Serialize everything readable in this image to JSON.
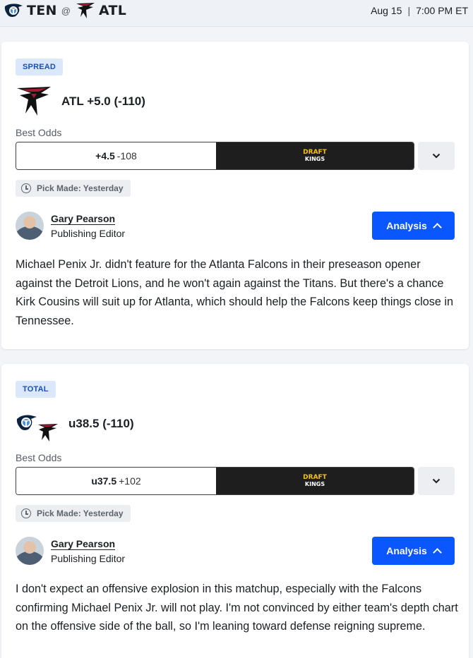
{
  "header": {
    "away_team": "TEN",
    "at_symbol": "@",
    "home_team": "ATL",
    "date": "Aug 15",
    "separator": "|",
    "time": "7:00 PM ET"
  },
  "picks": [
    {
      "badge": "SPREAD",
      "pick_label": "ATL +5.0 (-110)",
      "best_odds_label": "Best Odds",
      "odds_line": "+4.5",
      "odds_price": "-108",
      "sportsbook": {
        "top": "DRAFT",
        "bottom": "KINGS"
      },
      "pick_made": "Pick Made: Yesterday",
      "author_name": "Gary Pearson",
      "author_role": "Publishing Editor",
      "analysis_label": "Analysis",
      "body": "Michael Penix Jr. didn't feature for the Atlanta Falcons in their preseason opener against the Detroit Lions, and he won't again against the Titans. But there's a chance Kirk Cousins will suit up for Atlanta, which should help the Falcons keep things close in Tennessee."
    },
    {
      "badge": "TOTAL",
      "pick_label": "u38.5 (-110)",
      "best_odds_label": "Best Odds",
      "odds_line": "u37.5",
      "odds_price": "+102",
      "sportsbook": {
        "top": "DRAFT",
        "bottom": "KINGS"
      },
      "pick_made": "Pick Made: Yesterday",
      "author_name": "Gary Pearson",
      "author_role": "Publishing Editor",
      "analysis_label": "Analysis",
      "body": "I don't expect an offensive explosion in this matchup, especially with the Falcons confirming Michael Penix Jr. will not play. I'm not convinced by either team's depth chart on the offensive side of the ball, so I'm leaning toward defense reigning supreme."
    }
  ],
  "icons": {
    "titans_logo": "titans-logo-icon",
    "falcons_logo": "falcons-logo-icon",
    "clock": "clock-icon",
    "chevron_down": "chevron-down-icon",
    "chevron_up": "chevron-up-icon"
  },
  "colors": {
    "accent_blue": "#0a56ff",
    "badge_bg": "#dbe8fb",
    "book_bg": "#1e1e1e",
    "falcons_red": "#a71930"
  }
}
